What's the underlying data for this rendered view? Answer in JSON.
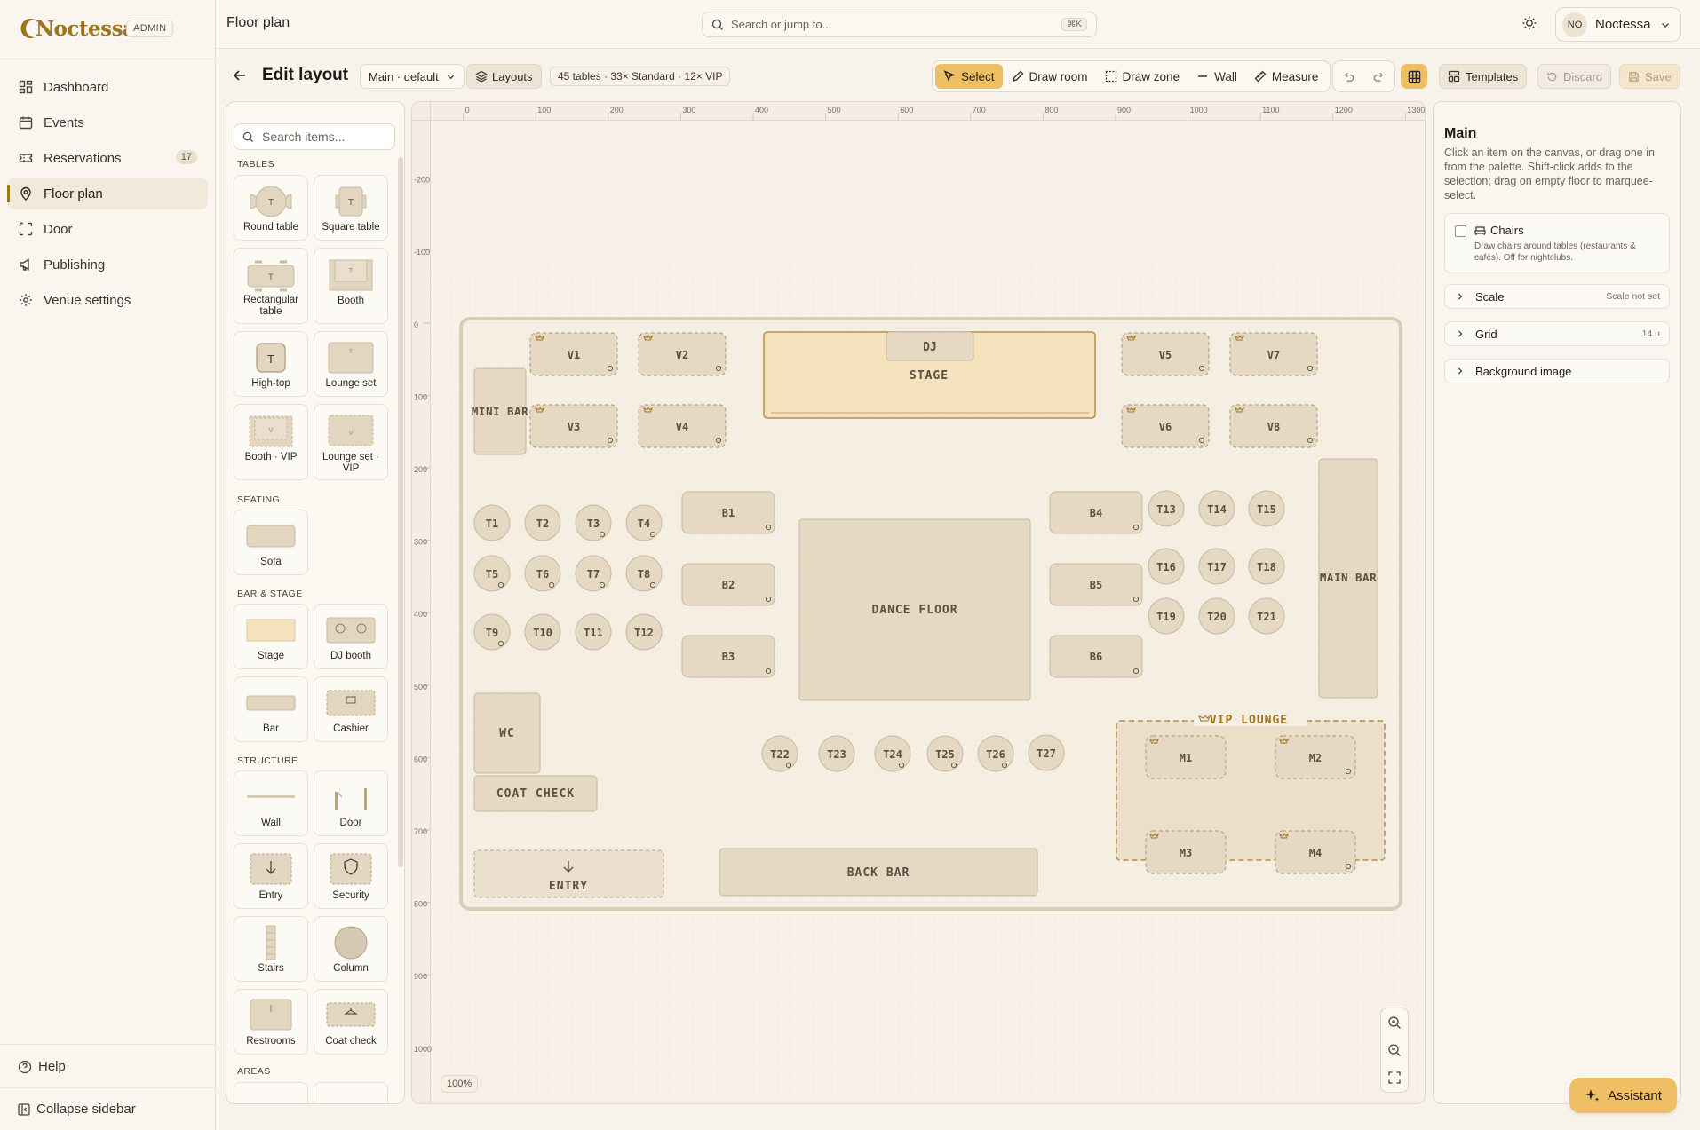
{
  "app": {
    "brand": "Noctessa",
    "badge": "ADMIN",
    "page_title": "Floor plan"
  },
  "nav": [
    {
      "label": "Dashboard",
      "icon": "dashboard-icon"
    },
    {
      "label": "Events",
      "icon": "calendar-icon"
    },
    {
      "label": "Reservations",
      "icon": "ticket-icon",
      "badge": "17"
    },
    {
      "label": "Floor plan",
      "icon": "map-pin-icon",
      "active": true
    },
    {
      "label": "Door",
      "icon": "scan-icon"
    },
    {
      "label": "Publishing",
      "icon": "megaphone-icon"
    },
    {
      "label": "Venue settings",
      "icon": "gear-icon"
    }
  ],
  "sidebar_footer": {
    "help": "Help",
    "collapse": "Collapse sidebar"
  },
  "search": {
    "placeholder": "Search or jump to...",
    "shortcut": "⌘K"
  },
  "user": {
    "initials": "NO",
    "name": "Noctessa"
  },
  "toolbar": {
    "title": "Edit layout",
    "layout_select": "Main · default",
    "layouts_label": "Layouts",
    "stats": "45 tables · 33× Standard · 12× VIP",
    "tools": [
      "Select",
      "Draw room",
      "Draw zone",
      "Wall",
      "Measure"
    ],
    "active_tool": "Select",
    "templates_label": "Templates",
    "discard_label": "Discard",
    "save_label": "Save"
  },
  "palette": {
    "search_placeholder": "Search items...",
    "sections": {
      "tables": "TABLES",
      "seating": "SEATING",
      "bar_stage": "BAR & STAGE",
      "structure": "STRUCTURE",
      "areas": "AREAS"
    },
    "tables": [
      "Round table",
      "Square table",
      "Rectangular table",
      "Booth",
      "High-top",
      "Lounge set",
      "Booth · VIP",
      "Lounge set · VIP"
    ],
    "seating": [
      "Sofa"
    ],
    "bar_stage": [
      "Stage",
      "DJ booth",
      "Bar",
      "Cashier"
    ],
    "structure": [
      "Wall",
      "Door",
      "Entry",
      "Security",
      "Stairs",
      "Column",
      "Restrooms",
      "Coat check"
    ]
  },
  "canvas": {
    "ruler_x": [
      "0",
      "100",
      "200",
      "300",
      "400",
      "500",
      "600",
      "700",
      "800",
      "900",
      "1000",
      "1100",
      "1200",
      "1300"
    ],
    "ruler_y": [
      "-200",
      "-100",
      "0",
      "100",
      "200",
      "300",
      "400",
      "500",
      "600",
      "700",
      "800",
      "900",
      "1000"
    ],
    "zoom": "100%",
    "labels": {
      "stage": "STAGE",
      "dj": "DJ",
      "mini_bar": "MINI BAR",
      "dance_floor": "DANCE FLOOR",
      "main_bar": "MAIN BAR",
      "wc": "WC",
      "coat_check": "COAT CHECK",
      "entry": "ENTRY",
      "back_bar": "BACK BAR",
      "vip_lounge": "VIP LOUNGE"
    },
    "vip_tables": [
      "V1",
      "V2",
      "V3",
      "V4",
      "V5",
      "V6",
      "V7",
      "V8"
    ],
    "booths": [
      "B1",
      "B2",
      "B3",
      "B4",
      "B5",
      "B6"
    ],
    "round_tables": [
      "T1",
      "T2",
      "T3",
      "T4",
      "T5",
      "T6",
      "T7",
      "T8",
      "T9",
      "T10",
      "T11",
      "T12",
      "T13",
      "T14",
      "T15",
      "T16",
      "T17",
      "T18",
      "T19",
      "T20",
      "T21",
      "T22",
      "T23",
      "T24",
      "T25",
      "T26",
      "T27"
    ],
    "lounge_tables": [
      "M1",
      "M2",
      "M3",
      "M4"
    ]
  },
  "inspector": {
    "title": "Main",
    "description": "Click an item on the canvas, or drag one in from the palette. Shift-click adds to the selection; drag on empty floor to marquee-select.",
    "chairs_title": "Chairs",
    "chairs_desc": "Draw chairs around tables (restaurants & cafés). Off for nightclubs.",
    "scale_label": "Scale",
    "scale_value": "Scale not set",
    "grid_label": "Grid",
    "grid_value": "14 u",
    "bg_label": "Background image"
  },
  "assistant_label": "Assistant",
  "colors": {
    "accent": "#eebf62",
    "brand": "#a0741f",
    "item_fill": "#e6d9c4",
    "item_stroke": "#c9b89c",
    "stage_fill": "#f3e2bb"
  }
}
